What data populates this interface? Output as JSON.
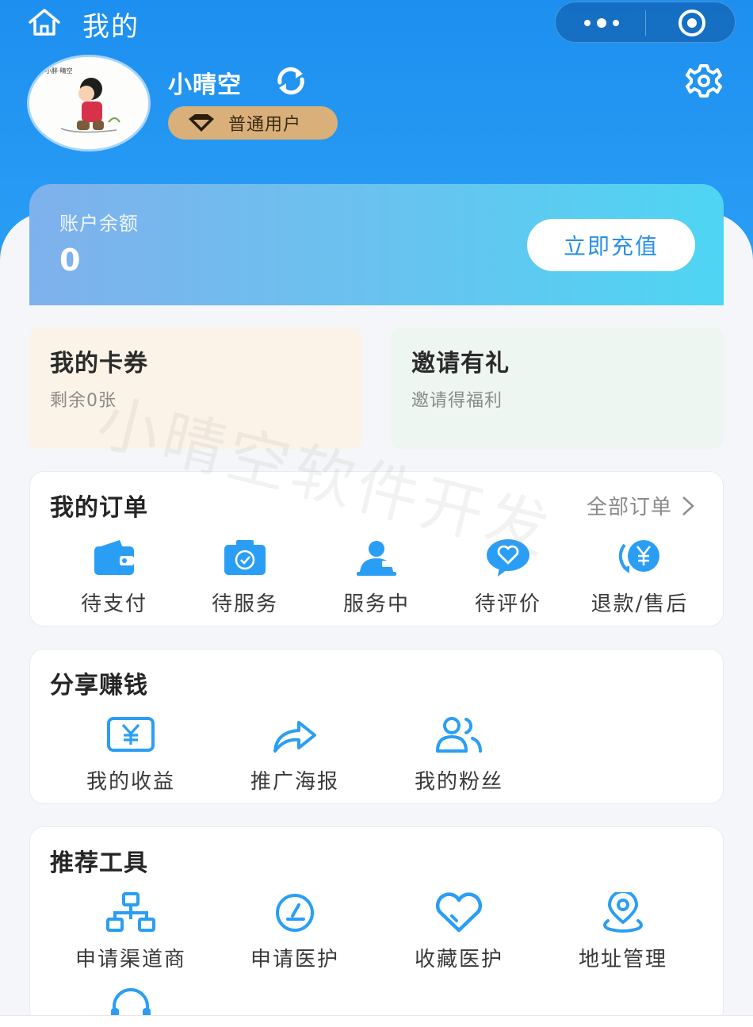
{
  "colors": {
    "primary": "#1d8ff0",
    "icon_blue": "#2a9ef5",
    "badge_gold": "#d9b07a"
  },
  "nav": {
    "title": "我的",
    "home_icon": "home-icon",
    "more_icon": "more-dots-icon",
    "close_icon": "target-icon"
  },
  "profile": {
    "username": "小晴空",
    "level_badge": "普通用户"
  },
  "balance": {
    "label": "账户余额",
    "value": "0",
    "recharge_button": "立即充值"
  },
  "cards": [
    {
      "title": "我的卡券",
      "subtitle": "剩余0张"
    },
    {
      "title": "邀请有礼",
      "subtitle": "邀请得福利"
    }
  ],
  "orders": {
    "title": "我的订单",
    "all_link": "全部订单",
    "items": [
      {
        "label": "待支付",
        "icon": "wallet-icon"
      },
      {
        "label": "待服务",
        "icon": "camera-check-icon"
      },
      {
        "label": "服务中",
        "icon": "user-service-icon"
      },
      {
        "label": "待评价",
        "icon": "heart-chat-icon"
      },
      {
        "label": "退款/售后",
        "icon": "refund-icon"
      }
    ]
  },
  "share": {
    "title": "分享赚钱",
    "items": [
      {
        "label": "我的收益",
        "icon": "yuan-card-icon"
      },
      {
        "label": "推广海报",
        "icon": "share-arrow-icon"
      },
      {
        "label": "我的粉丝",
        "icon": "fans-icon"
      }
    ]
  },
  "tools": {
    "title": "推荐工具",
    "items": [
      {
        "label": "申请渠道商",
        "icon": "network-icon"
      },
      {
        "label": "申请医护",
        "icon": "medical-icon"
      },
      {
        "label": "收藏医护",
        "icon": "heart-icon"
      },
      {
        "label": "地址管理",
        "icon": "location-icon"
      }
    ]
  },
  "watermark": "小晴空软件开发"
}
